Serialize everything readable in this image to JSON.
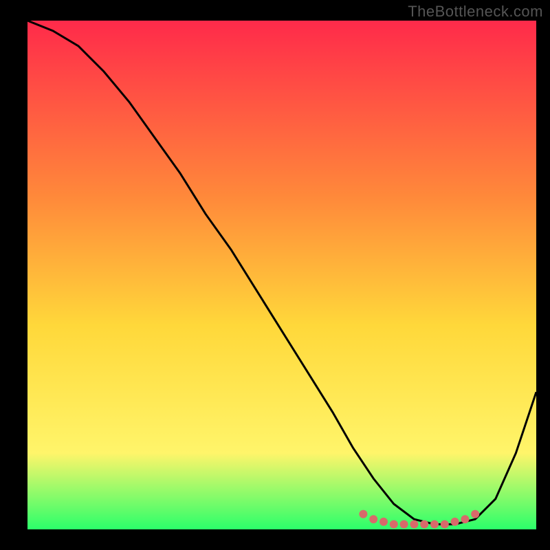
{
  "watermark": "TheBottleneck.com",
  "chart_data": {
    "type": "line",
    "title": "",
    "xlabel": "",
    "ylabel": "",
    "xlim": [
      0,
      100
    ],
    "ylim": [
      0,
      100
    ],
    "grid": false,
    "legend": false,
    "background_gradient": {
      "top": "#ff2a4a",
      "mid_upper": "#ff8a3a",
      "mid": "#ffd83a",
      "mid_lower": "#fff56a",
      "bottom": "#2bff6a"
    },
    "series": [
      {
        "name": "bottleneck-curve",
        "color": "#000000",
        "x": [
          0,
          5,
          10,
          15,
          20,
          25,
          30,
          35,
          40,
          45,
          50,
          55,
          60,
          64,
          68,
          72,
          76,
          80,
          84,
          88,
          92,
          96,
          100
        ],
        "y": [
          100,
          98,
          95,
          90,
          84,
          77,
          70,
          62,
          55,
          47,
          39,
          31,
          23,
          16,
          10,
          5,
          2,
          1,
          1,
          2,
          6,
          15,
          27
        ]
      },
      {
        "name": "optimal-zone-markers",
        "type": "scatter",
        "color": "#d86a6a",
        "x": [
          66,
          68,
          70,
          72,
          74,
          76,
          78,
          80,
          82,
          84,
          86,
          88
        ],
        "y": [
          3,
          2,
          1.5,
          1,
          1,
          1,
          1,
          1,
          1,
          1.5,
          2,
          3
        ]
      }
    ]
  }
}
